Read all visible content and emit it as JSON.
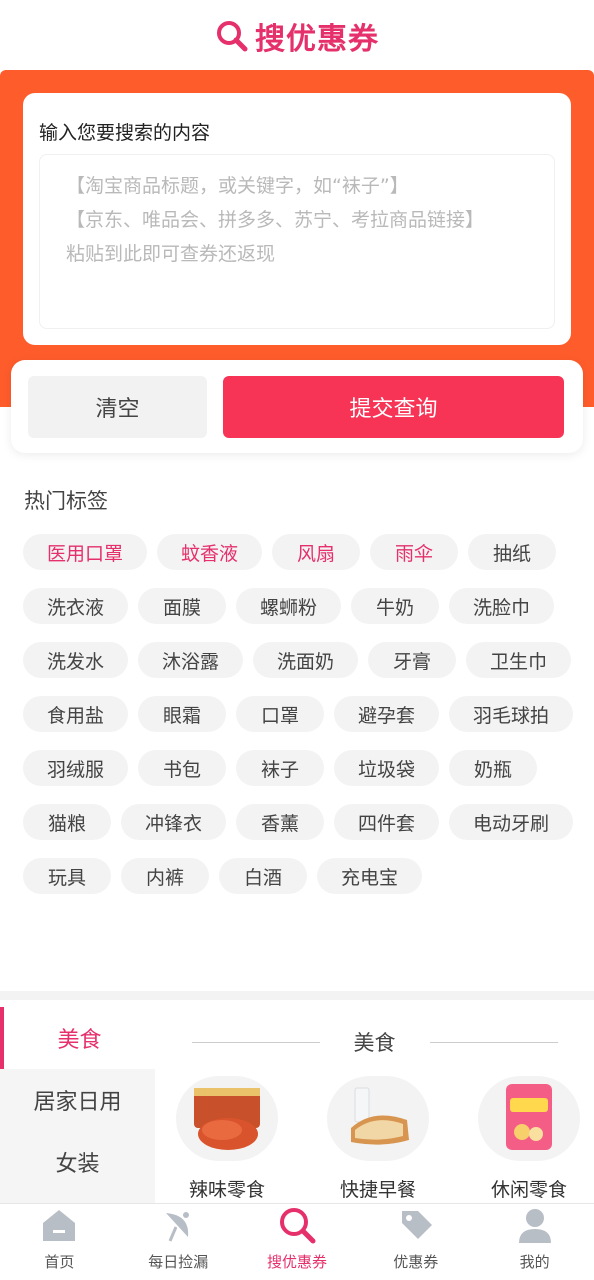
{
  "header": {
    "title": "搜优惠券",
    "logo_icon": "magnifier-icon",
    "accent": "#e5306b"
  },
  "search": {
    "label": "输入您要搜索的内容",
    "placeholder_lines": [
      "【淘宝商品标题，或关键字，如“袜子”】",
      "【京东、唯品会、拼多多、苏宁、考拉商品链接】",
      "粘贴到此即可查券还返现"
    ]
  },
  "actions": {
    "clear_label": "清空",
    "submit_label": "提交查询",
    "submit_color": "#f73456"
  },
  "hot": {
    "title": "热门标签",
    "tags": [
      {
        "label": "医用口罩",
        "hot": true
      },
      {
        "label": "蚊香液",
        "hot": true
      },
      {
        "label": "风扇",
        "hot": true
      },
      {
        "label": "雨伞",
        "hot": true
      },
      {
        "label": "抽纸",
        "hot": false
      },
      {
        "label": "洗衣液",
        "hot": false
      },
      {
        "label": "面膜",
        "hot": false
      },
      {
        "label": "螺蛳粉",
        "hot": false
      },
      {
        "label": "牛奶",
        "hot": false
      },
      {
        "label": "洗脸巾",
        "hot": false
      },
      {
        "label": "洗发水",
        "hot": false
      },
      {
        "label": "沐浴露",
        "hot": false
      },
      {
        "label": "洗面奶",
        "hot": false
      },
      {
        "label": "牙膏",
        "hot": false
      },
      {
        "label": "卫生巾",
        "hot": false
      },
      {
        "label": "食用盐",
        "hot": false
      },
      {
        "label": "眼霜",
        "hot": false
      },
      {
        "label": "口罩",
        "hot": false
      },
      {
        "label": "避孕套",
        "hot": false
      },
      {
        "label": "羽毛球拍",
        "hot": false
      },
      {
        "label": "羽绒服",
        "hot": false
      },
      {
        "label": "书包",
        "hot": false
      },
      {
        "label": "袜子",
        "hot": false
      },
      {
        "label": "垃圾袋",
        "hot": false
      },
      {
        "label": "奶瓶",
        "hot": false
      },
      {
        "label": "猫粮",
        "hot": false
      },
      {
        "label": "冲锋衣",
        "hot": false
      },
      {
        "label": "香薰",
        "hot": false
      },
      {
        "label": "四件套",
        "hot": false
      },
      {
        "label": "电动牙刷",
        "hot": false
      },
      {
        "label": "玩具",
        "hot": false
      },
      {
        "label": "内裤",
        "hot": false
      },
      {
        "label": "白酒",
        "hot": false
      },
      {
        "label": "充电宝",
        "hot": false
      }
    ]
  },
  "categories": {
    "side": [
      {
        "label": "美食",
        "active": true
      },
      {
        "label": "居家日用",
        "active": false
      },
      {
        "label": "女装",
        "active": false
      }
    ],
    "current_title": "美食",
    "products": [
      {
        "name": "辣味零食",
        "icon": "spicy-strip-icon"
      },
      {
        "name": "快捷早餐",
        "icon": "bread-milk-icon"
      },
      {
        "name": "休闲零食",
        "icon": "chips-bag-icon"
      }
    ]
  },
  "tabbar": [
    {
      "label": "首页",
      "icon": "home-icon",
      "active": false
    },
    {
      "label": "每日捡漏",
      "icon": "satellite-dish-icon",
      "active": false
    },
    {
      "label": "搜优惠券",
      "icon": "search-icon",
      "active": true
    },
    {
      "label": "优惠券",
      "icon": "coupon-tag-icon",
      "active": false
    },
    {
      "label": "我的",
      "icon": "user-icon",
      "active": false
    }
  ]
}
